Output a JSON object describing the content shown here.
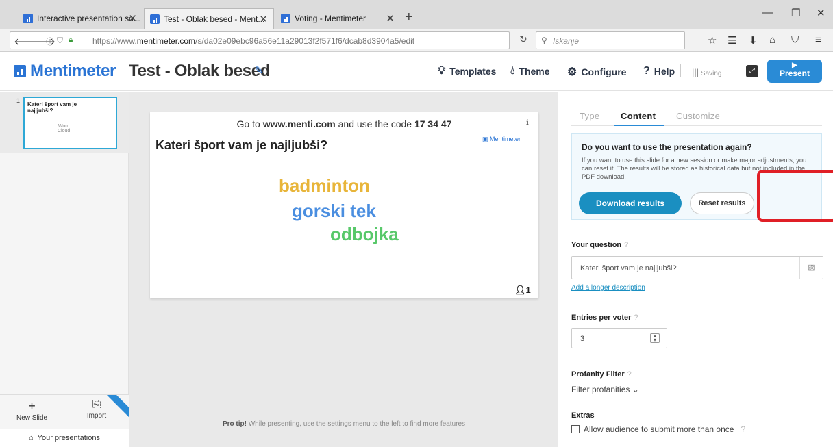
{
  "browser": {
    "tabs": [
      {
        "label": "Interactive presentation so...",
        "active": false
      },
      {
        "label": "Test - Oblak besed - Ment...",
        "active": true
      },
      {
        "label": "Voting - Mentimeter",
        "active": false
      }
    ],
    "url_prefix": "https://www.",
    "url_domain": "mentimeter.com",
    "url_path": "/s/da02e09ebc96a56e11a29013f2f571f6/dcab8d3904a5/edit",
    "search_placeholder": "Iskanje"
  },
  "header": {
    "logo": "Mentimeter",
    "title": "Test - Oblak besed",
    "templates": "Templates",
    "theme": "Theme",
    "configure": "Configure",
    "help": "Help",
    "saving": "Saving",
    "present": "Present"
  },
  "slides_panel": {
    "slides": [
      {
        "number": "1",
        "title": "Kateri šport vam je najljubši?",
        "type_label": "Word\nCloud"
      }
    ],
    "new_slide": "New Slide",
    "import": "Import",
    "your_presentations": "Your presentations"
  },
  "slide": {
    "instruction_pre": "Go to ",
    "instruction_site": "www.menti.com",
    "instruction_mid": " and use the code ",
    "instruction_code": "17 34 47",
    "question": "Kateri šport vam je najljubši?",
    "brand": "Mentimeter",
    "participants": "1",
    "words": [
      {
        "text": "badminton",
        "color": "#e8b53a"
      },
      {
        "text": "gorski tek",
        "color": "#4a8ee0"
      },
      {
        "text": "odbojka",
        "color": "#58c86a"
      }
    ]
  },
  "protip": {
    "label": "Pro tip!",
    "text": " While presenting, use the settings menu to the left to find more features"
  },
  "editor": {
    "tabs": [
      "Type",
      "Content",
      "Customize"
    ],
    "reuse_title": "Do you want to use the presentation again?",
    "reuse_text": "If you want to use this slide for a new session or make major adjustments, you can reset it. The results will be stored as historical data but not included in the PDF download.",
    "download_results": "Download results",
    "reset_results": "Reset results",
    "your_question_label": "Your question",
    "question_value": "Kateri šport vam je najljubši?",
    "add_description": "Add a longer description",
    "entries_label": "Entries per voter",
    "entries_value": "3",
    "profanity_label": "Profanity Filter",
    "filter_profanities": "Filter profanities",
    "extras_label": "Extras",
    "allow_multiple": "Allow audience to submit more than once",
    "help_mark": "?"
  },
  "colors": {
    "brand_blue": "#2a74d4",
    "button_blue": "#1a8fc1",
    "highlight_red": "#e01f26"
  }
}
